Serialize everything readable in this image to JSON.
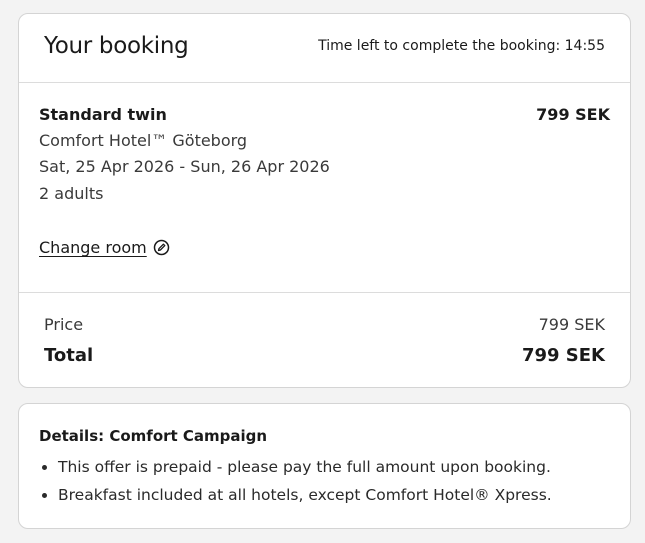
{
  "booking": {
    "title": "Your booking",
    "timer_text": "Time left to complete the booking: 14:55",
    "room": {
      "name": "Standard twin",
      "price": "799 SEK",
      "hotel": "Comfort Hotel™ Göteborg",
      "dates": "Sat, 25 Apr 2026 - Sun, 26 Apr 2026",
      "guests": "2 adults",
      "change_label": "Change room",
      "change_icon": "edit-pencil-icon"
    },
    "summary": {
      "price_label": "Price",
      "price_value": "799 SEK",
      "total_label": "Total",
      "total_value": "799 SEK"
    }
  },
  "details": {
    "title": "Details: Comfort Campaign",
    "items": [
      "This offer is prepaid - please pay the full amount upon booking.",
      "Breakfast included at all hotels, except Comfort Hotel® Xpress."
    ]
  }
}
